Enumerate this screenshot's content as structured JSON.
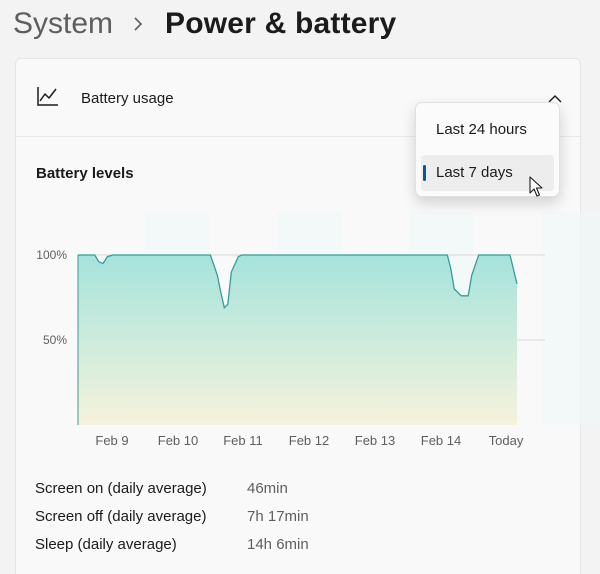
{
  "breadcrumb": {
    "parent": "System",
    "current": "Power & battery"
  },
  "battery_usage": {
    "title": "Battery usage"
  },
  "section": {
    "title": "Battery levels"
  },
  "dropdown": {
    "options": [
      "Last 24 hours",
      "Last 7 days"
    ],
    "selected": "Last 7 days"
  },
  "chart_data": {
    "type": "area",
    "categories": [
      "Feb 9",
      "Feb 10",
      "Feb 11",
      "Feb 12",
      "Feb 13",
      "Feb 14",
      "Today"
    ],
    "yticks": [
      "100%",
      "50%"
    ],
    "ylim": [
      0,
      100
    ],
    "xlim": [
      0,
      6.5
    ],
    "x": [
      0,
      0.24,
      0.3,
      0.36,
      0.42,
      0.5,
      1.9,
      2.0,
      2.05,
      2.1,
      2.15,
      2.2,
      2.3,
      2.35,
      2.45,
      5.3,
      5.35,
      5.4,
      5.5,
      5.6,
      5.65,
      5.75,
      6.2,
      6.3
    ],
    "values": [
      100,
      100,
      96,
      95,
      99,
      100,
      100,
      88,
      78,
      69,
      71,
      90,
      99,
      100,
      100,
      100,
      92,
      80,
      76,
      76,
      88,
      100,
      100,
      83
    ],
    "colors": {
      "line": "#3a9a96",
      "fill_top": "#a5e3dc",
      "fill_bottom": "#f6f3dc",
      "grid": "#d8d8d8"
    },
    "grid": true,
    "legend": "none"
  },
  "stats": [
    {
      "label": "Screen on (daily average)",
      "value": "46min"
    },
    {
      "label": "Screen off (daily average)",
      "value": "7h 17min"
    },
    {
      "label": "Sleep (daily average)",
      "value": "14h 6min"
    }
  ]
}
